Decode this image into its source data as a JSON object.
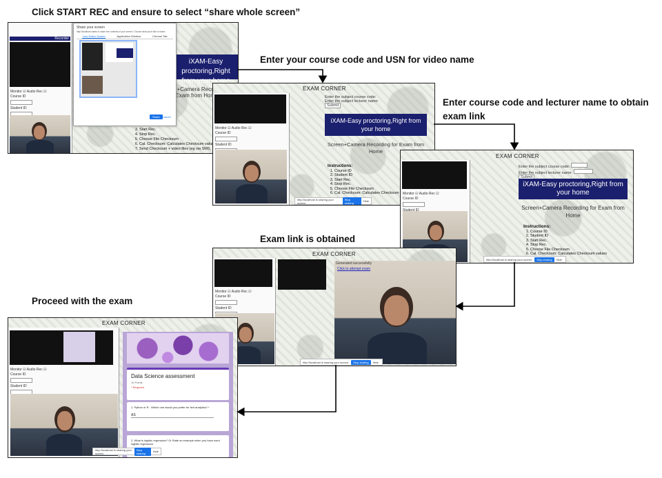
{
  "captions": {
    "step1": "Click START REC and ensure to select “share whole screen”",
    "step2": "Enter your course code and USN for video name",
    "step3": "Enter course code and lecturer name to obtain exam link",
    "step4": "Exam link is obtained",
    "step5": "Proceed with the exam"
  },
  "app": {
    "header": "EXAM CORNER",
    "recorder_label": "Recorder",
    "banner": "iXAM-Easy proctoring,Right from your home",
    "subbanner": "Screen+Camera Recording for Exam from Home",
    "instructions_title": "Instructions:",
    "instructions": [
      "Course ID",
      "Student ID",
      "Start Rec.",
      "Stop Rec.",
      "Choose File Checksum",
      "Cal. Checksum: Calculates Checksum values",
      "Send Checksum + video files (eg via SMS,"
    ],
    "monitor_label": "Monitor",
    "audio_label": "Audio Rec",
    "course_id_label": "Course ID",
    "student_id_label": "Student ID",
    "course_code_prompt": "Enter the subject course code:",
    "lecturer_prompt": "Enter the subject lecturer name:",
    "submit_label": "Submit",
    "share_notice": "http://localhost is sharing your screen.",
    "stop_sharing": "Stop sharing",
    "hide": "Hide",
    "link_success": "Generated successfully",
    "exam_link": "Click to attempt exam"
  },
  "share_dialog": {
    "title": "Share your screen",
    "subtitle": "http://localhost wants to share the contents of your screen. Choose what you'd like to share.",
    "tabs": [
      "Your Entire Screen",
      "Application Window",
      "Chrome Tab"
    ],
    "share_button": "Share",
    "cancel_button": "Cancel"
  },
  "form": {
    "title": "Data Science assessment",
    "points": "10 Points",
    "required": "* Required",
    "q1": "1. Python or R - Which one would you prefer for text analytics? *",
    "a1": "AS",
    "q2": "2. What is logistic regression? Or State an example when you have used logistic regression"
  },
  "colors": {
    "banner": "#1a1f6e",
    "arrow": "#000000",
    "share_blue": "#1a73e8",
    "form_purple": "#b9a6d6"
  }
}
